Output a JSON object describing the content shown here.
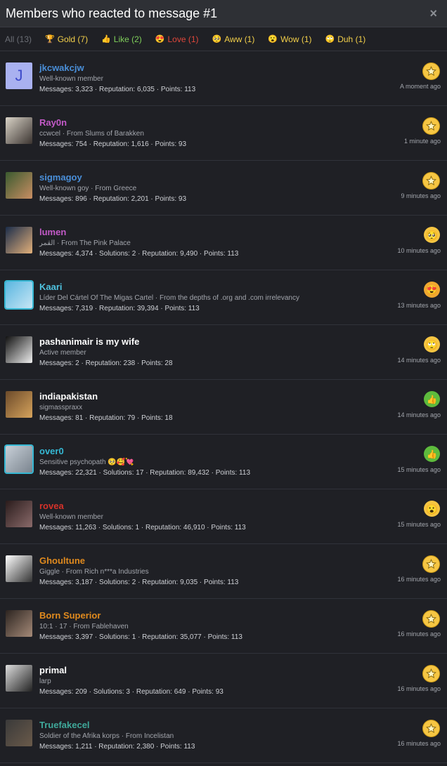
{
  "header": {
    "title": "Members who reacted to message #1",
    "close": "×"
  },
  "tabs": [
    {
      "label": "All (13)",
      "color": "#6b6e75",
      "icon": ""
    },
    {
      "label": "Gold (7)",
      "color": "#f3d04a",
      "icon": "gold-icon"
    },
    {
      "label": "Like (2)",
      "color": "#7fcf5a",
      "icon": "like-icon"
    },
    {
      "label": "Love (1)",
      "color": "#e0473b",
      "icon": "love-icon"
    },
    {
      "label": "Aww (1)",
      "color": "#f3d04a",
      "icon": "aww-icon"
    },
    {
      "label": "Wow (1)",
      "color": "#f3d04a",
      "icon": "wow-icon"
    },
    {
      "label": "Duh (1)",
      "color": "#f3d04a",
      "icon": "duh-icon"
    }
  ],
  "members": [
    {
      "name": "jkcwakcjw",
      "name_color": "#4a8fd9",
      "title": "Well-known member",
      "stats": "Messages: 3,323 · Reputation: 6,035 · Points: 113",
      "reaction": "gold",
      "time": "A moment ago",
      "avatar_letter": "J"
    },
    {
      "name": "Ray0n",
      "name_color": "#c35ac8",
      "title": "ccwcel · From Slums of Barakken",
      "stats": "Messages: 754 · Reputation: 1,616 · Points: 93",
      "reaction": "gold",
      "time": "1 minute ago"
    },
    {
      "name": "sigmagoy",
      "name_color": "#4a8fd9",
      "title": "Well-known goy · From Greece",
      "stats": "Messages: 896 · Reputation: 2,201 · Points: 93",
      "reaction": "gold",
      "time": "9 minutes ago"
    },
    {
      "name": "lumen",
      "name_color": "#c35ac8",
      "title": "القمر · From The Pink Palace",
      "stats": "Messages: 4,374 · Solutions: 2 · Reputation: 9,490 · Points: 113",
      "reaction": "aww",
      "time": "10 minutes ago"
    },
    {
      "name": "Kaari",
      "name_color": "#4fc3e0",
      "title": "Líder Del Cártel Of The Migas Cartel · From the depths of .org and .com irrelevancy",
      "stats": "Messages: 7,319 · Reputation: 39,394 · Points: 113",
      "reaction": "love",
      "time": "13 minutes ago"
    },
    {
      "name": "pashanimair is my wife",
      "name_color": "#ffffff",
      "title": "Active member",
      "stats": "Messages: 2 · Reputation: 238 · Points: 28",
      "reaction": "duh",
      "time": "14 minutes ago"
    },
    {
      "name": "indiapakistan",
      "name_color": "#ffffff",
      "title": "sigmasspraxx",
      "stats": "Messages: 81 · Reputation: 79 · Points: 18",
      "reaction": "like",
      "time": "14 minutes ago"
    },
    {
      "name": "over0",
      "name_color": "#35b8d4",
      "title": "Sensitive psychopath 🥺🥰💘",
      "stats": "Messages: 22,321 · Solutions: 17 · Reputation: 89,432 · Points: 113",
      "reaction": "like",
      "time": "15 minutes ago"
    },
    {
      "name": "rovea",
      "name_color": "#d6322a",
      "title": "Well-known member",
      "stats": "Messages: 11,263 · Solutions: 1 · Reputation: 46,910 · Points: 113",
      "reaction": "wow",
      "time": "15 minutes ago"
    },
    {
      "name": "Ghoultune",
      "name_color": "#e08a1e",
      "title": "Giggle · From Rich n***a Industries",
      "stats": "Messages: 3,187 · Solutions: 2 · Reputation: 9,035 · Points: 113",
      "reaction": "gold",
      "time": "16 minutes ago"
    },
    {
      "name": "Born Superior",
      "name_color": "#e08a1e",
      "title": "10:1 · 17 · From Fablehaven",
      "stats": "Messages: 3,397 · Solutions: 1 · Reputation: 35,077 · Points: 113",
      "reaction": "gold",
      "time": "16 minutes ago"
    },
    {
      "name": "primal",
      "name_color": "#ffffff",
      "title": "larp",
      "stats": "Messages: 209 · Solutions: 3 · Reputation: 649 · Points: 93",
      "reaction": "gold",
      "time": "16 minutes ago"
    },
    {
      "name": "Truefakecel",
      "name_color": "#3fa89a",
      "title": "Soldier of the Afrika korps · From Incelistan",
      "stats": "Messages: 1,211 · Reputation: 2,380 · Points: 113",
      "reaction": "gold",
      "time": "16 minutes ago"
    }
  ]
}
